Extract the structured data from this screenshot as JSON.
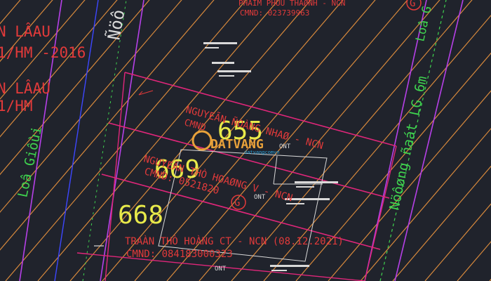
{
  "colors": {
    "background": "#20232c",
    "hatch": "#d7893c",
    "parcel_boundary": "#e0267a",
    "parcel_number": "#e8ea4a",
    "owner_text": "#e23a3a",
    "road_text": "#3fd44f",
    "outline": "#d9d9d9",
    "watermark": "#e8a13a",
    "watermark_site": "#2aa0d8",
    "purple": "#b640e8",
    "blue": "#3d47ff"
  },
  "left_labels": {
    "line1": "N LÂAU",
    "line2": "1/HM  -2016",
    "line3": "N LÂAU",
    "line4": "1/HM"
  },
  "road_labels": {
    "top_road": "Ñöô",
    "left_road": "Loâ Giôùi",
    "right_road": "Nöôøng ñaát LG 6m",
    "right_road_top": "Loâ G"
  },
  "top_owner": {
    "name": "PHAÏM PHUÙ THAØNH - NCN",
    "id": "CMND: 023739963"
  },
  "parcels": {
    "p655": {
      "number": "655",
      "owner": "NGUYEÃN   ÑOÀNG NHAØ - NCN",
      "id": "CMND"
    },
    "p669": {
      "number": "669",
      "owner": "NGUYEÃN THÒ HOAØNG V - NCN",
      "id": "CMND: 0521820"
    },
    "p668": {
      "number": "668",
      "owner": "TRAÀN THÒ HOÀNG CT  - NCN  (08.12.2021)",
      "id": "CMND:  084183000323"
    }
  },
  "land_use_labels": {
    "ont_a": "ONT",
    "ont_b": "ONT",
    "ont_c": "ONT"
  },
  "watermark": {
    "brand": "DATVANG",
    "site": "datvangcomvn"
  },
  "icons": {
    "top_right_mark": "circled-g-icon",
    "center_mark": "circled-g-icon",
    "arrow_mark": "arrow-icon"
  }
}
